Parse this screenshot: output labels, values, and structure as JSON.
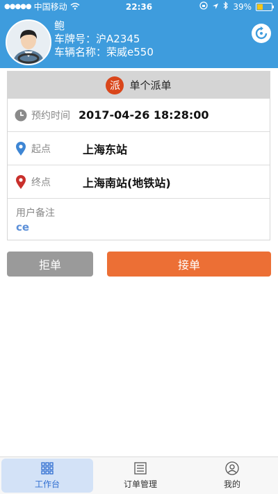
{
  "status_bar": {
    "carrier": "中国移动",
    "time": "22:36",
    "battery": "39%",
    "battery_level": 0.39
  },
  "driver": {
    "name": "鲍",
    "plate_label": "车牌号：",
    "plate": "沪A2345",
    "vehicle_label": "车辆名称：",
    "vehicle": "荣威e550"
  },
  "order": {
    "badge": "派",
    "title": "单个派单",
    "time_label": "预约时间",
    "time_value": "2017-04-26 18:28:00",
    "start_label": "起点",
    "start_value": "上海东站",
    "end_label": "终点",
    "end_value": "上海南站(地铁站)",
    "note_label": "用户备注",
    "note_value": "ce"
  },
  "actions": {
    "reject": "拒单",
    "accept": "接单"
  },
  "tabs": [
    {
      "label": "工作台",
      "icon": "grid-icon",
      "active": true
    },
    {
      "label": "订单管理",
      "icon": "list-icon",
      "active": false
    },
    {
      "label": "我的",
      "icon": "user-icon",
      "active": false
    }
  ],
  "colors": {
    "header": "#3e9cdd",
    "accept": "#ec6f35",
    "reject": "#9a9a9a",
    "badge": "#d9461b",
    "active_tab": "#2f6ed1"
  }
}
